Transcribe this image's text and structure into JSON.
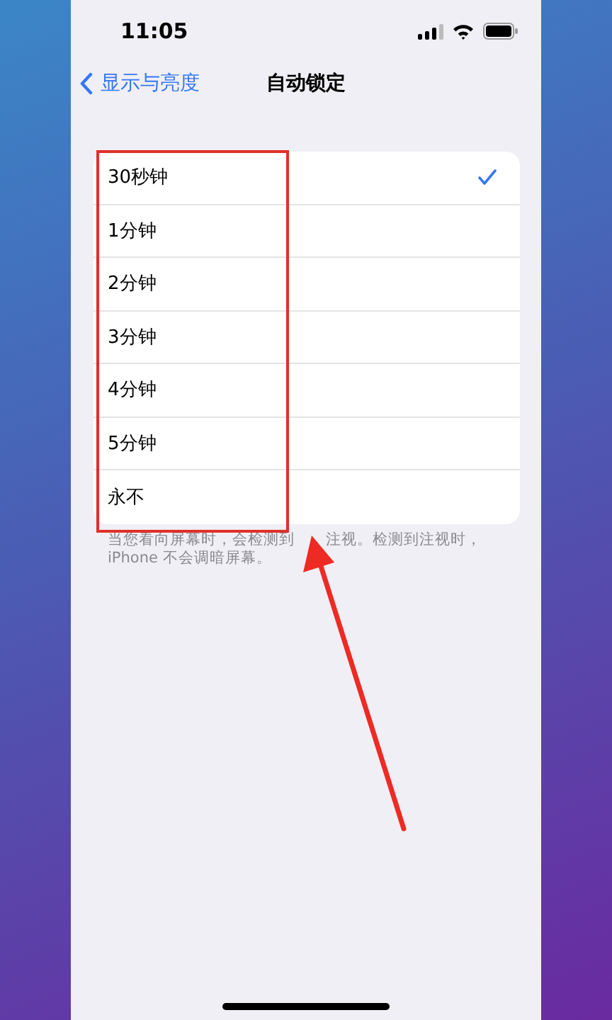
{
  "status_bar": {
    "time": "11:05"
  },
  "nav": {
    "back": "显示与亮度",
    "title": "自动锁定"
  },
  "options": [
    {
      "label": "30秒钟",
      "selected": true
    },
    {
      "label": "1分钟",
      "selected": false
    },
    {
      "label": "2分钟",
      "selected": false
    },
    {
      "label": "3分钟",
      "selected": false
    },
    {
      "label": "4分钟",
      "selected": false
    },
    {
      "label": "5分钟",
      "selected": false
    },
    {
      "label": "永不",
      "selected": false
    }
  ],
  "footer": {
    "line_1_start": "当您看向屏幕时，会检测到",
    "line_1_end": "注视。检测到注视时，",
    "line_2": "iPhone 不会调暗屏幕。"
  }
}
